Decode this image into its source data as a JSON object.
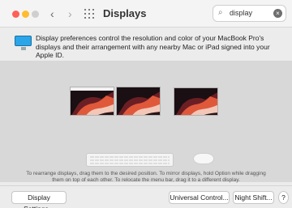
{
  "window": {
    "title": "Displays"
  },
  "nav": {
    "back": "‹",
    "forward": "›"
  },
  "search": {
    "value": "display",
    "clear": "×"
  },
  "info": {
    "text": "Display preferences control the resolution and color of your MacBook Pro's displays and their arrangement with any nearby Mac or iPad signed into your Apple ID."
  },
  "arrangement": {
    "help_line1": "To rearrange displays, drag them to the desired position. To mirror displays, hold Option while dragging",
    "help_line2": "them on top of each other. To relocate the menu bar, drag it to a different display."
  },
  "buttons": {
    "display_settings": "Display Settings...",
    "universal_control": "Universal Control...",
    "night_shift": "Night Shift...",
    "help": "?"
  }
}
